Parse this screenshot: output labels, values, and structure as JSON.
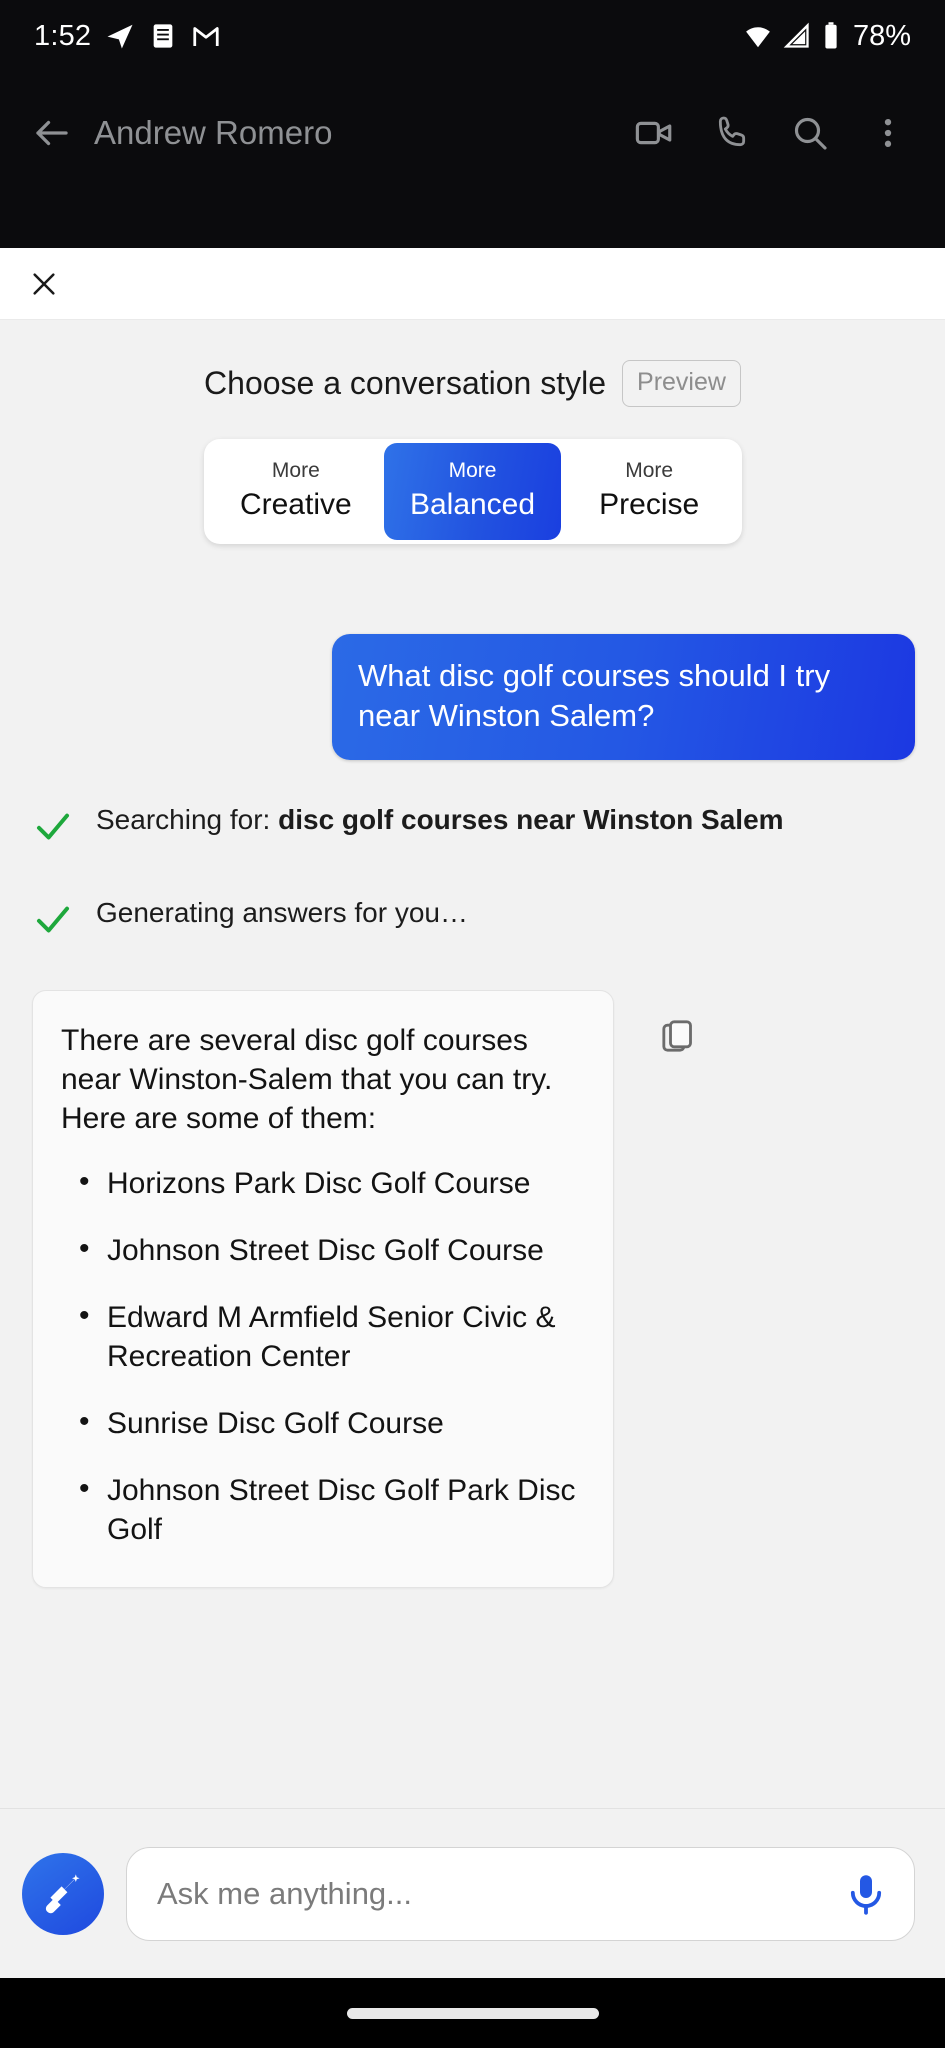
{
  "status_bar": {
    "time": "1:52",
    "battery": "78%",
    "icons": [
      "telegram-icon",
      "message-icon",
      "gmail-icon",
      "wifi-icon",
      "signal-icon",
      "battery-icon"
    ]
  },
  "app_header": {
    "back_icon": "back-arrow-icon",
    "contact_name": "Andrew Romero",
    "actions": [
      {
        "name": "video-call-icon",
        "label": "Video call"
      },
      {
        "name": "phone-call-icon",
        "label": "Call"
      },
      {
        "name": "search-icon",
        "label": "Search"
      },
      {
        "name": "overflow-menu-icon",
        "label": "More options"
      }
    ]
  },
  "overlay": {
    "close_icon": "close-icon"
  },
  "style_picker": {
    "title": "Choose a conversation style",
    "preview_badge": "Preview",
    "options": [
      {
        "small": "More",
        "big": "Creative",
        "active": false
      },
      {
        "small": "More",
        "big": "Balanced",
        "active": true
      },
      {
        "small": "More",
        "big": "Precise",
        "active": false
      }
    ],
    "active_color": "#2253e0"
  },
  "conversation": {
    "user_message": "What disc golf courses should I try near Winston Salem?",
    "user_bubble_color": "#2458e4",
    "status_steps": [
      {
        "prefix": "Searching for: ",
        "query": "disc golf courses near Winston Salem",
        "icon": "check-icon",
        "icon_color": "#1ea83c"
      },
      {
        "prefix": "Generating answers for you…",
        "query": "",
        "icon": "check-icon",
        "icon_color": "#1ea83c"
      }
    ],
    "answer": {
      "intro": "There are several disc golf courses near Winston-Salem that you can try. Here are some of them:",
      "items": [
        "Horizons Park Disc Golf Course",
        "Johnson Street Disc Golf Course",
        "Edward M Armfield Senior Civic & Recreation Center",
        "Sunrise Disc Golf Course",
        "Johnson Street Disc Golf Park Disc Golf"
      ],
      "copy_icon": "copy-icon"
    }
  },
  "composer": {
    "new_topic_icon": "broom-sweep-icon",
    "placeholder": "Ask me anything...",
    "input_value": "",
    "mic_icon": "microphone-icon",
    "accent_color": "#2458e4"
  },
  "system_nav": {
    "home_pill": "home-gesture-pill"
  }
}
